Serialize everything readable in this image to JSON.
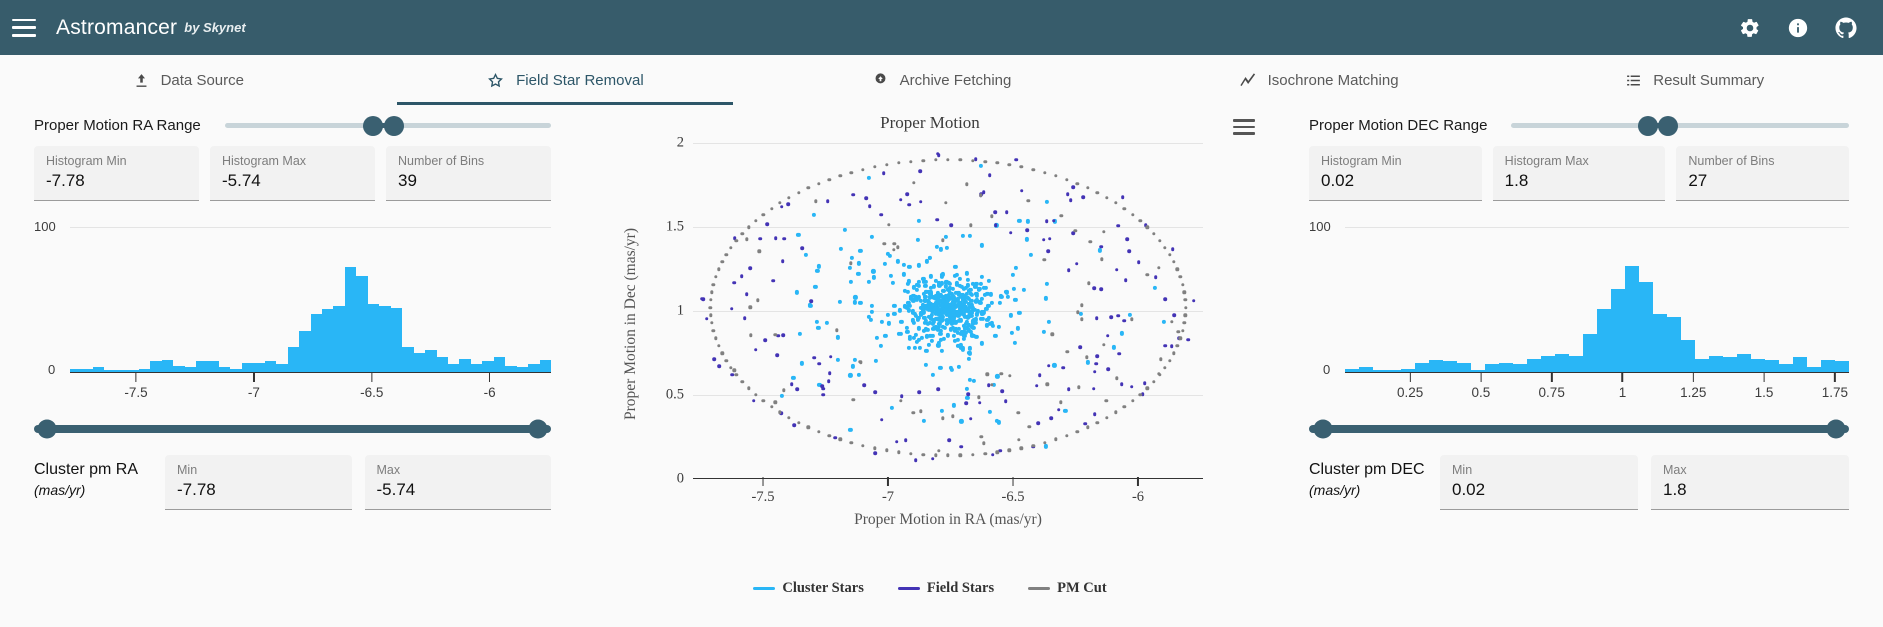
{
  "header": {
    "menu_icon": "hamburger-icon",
    "brand": "Astromancer",
    "brand_sub": "by Skynet",
    "icons": [
      "gear-icon",
      "info-icon",
      "github-icon"
    ]
  },
  "tabs": [
    {
      "label": "Data Source",
      "icon": "upload-icon",
      "active": false
    },
    {
      "label": "Field Star Removal",
      "icon": "star-icon",
      "active": true
    },
    {
      "label": "Archive Fetching",
      "icon": "download-icon",
      "active": false
    },
    {
      "label": "Isochrone Matching",
      "icon": "trending-icon",
      "active": false
    },
    {
      "label": "Result Summary",
      "icon": "list-icon",
      "active": false
    }
  ],
  "left_panel": {
    "range_label": "Proper Motion RA Range",
    "slider": {
      "left_pct": 45.5,
      "right_pct": 52.0
    },
    "fields": [
      {
        "label": "Histogram Min",
        "value": "-7.78"
      },
      {
        "label": "Histogram Max",
        "value": "-5.74"
      },
      {
        "label": "Number of Bins",
        "value": "39"
      }
    ],
    "bottom_slider": {
      "left_pct": 2.5,
      "right_pct": 97.5
    },
    "cluster": {
      "title": "Cluster pm RA",
      "units": "(mas/yr)",
      "min_label": "Min",
      "min_value": "-7.78",
      "max_label": "Max",
      "max_value": "-5.74"
    }
  },
  "right_panel": {
    "range_label": "Proper Motion DEC Range",
    "slider": {
      "left_pct": 40.5,
      "right_pct": 46.5
    },
    "fields": [
      {
        "label": "Histogram Min",
        "value": "0.02"
      },
      {
        "label": "Histogram Max",
        "value": "1.8"
      },
      {
        "label": "Number of Bins",
        "value": "27"
      }
    ],
    "bottom_slider": {
      "left_pct": 2.5,
      "right_pct": 97.5
    },
    "cluster": {
      "title": "Cluster pm DEC",
      "units": "(mas/yr)",
      "min_label": "Min",
      "min_value": "0.02",
      "max_label": "Max",
      "max_value": "1.8"
    }
  },
  "chart_data": [
    {
      "id": "hist_ra",
      "type": "bar",
      "title": "",
      "xlabel": "",
      "ylabel": "",
      "ylim": [
        0,
        100
      ],
      "xlim": [
        -7.78,
        -5.74
      ],
      "ytick_labels": [
        "100",
        "0"
      ],
      "xtick_labels": [
        "-7.5",
        "-7",
        "-6.5",
        "-6"
      ],
      "xtick_values": [
        -7.5,
        -7,
        -6.5,
        -6
      ],
      "grid": true,
      "bar_color": "#29b6f6",
      "bin_count": 39,
      "values": [
        2,
        2,
        3,
        1,
        0,
        1,
        2,
        7,
        8,
        4,
        3,
        7,
        7,
        3,
        2,
        6,
        6,
        7,
        5,
        17,
        28,
        40,
        43,
        45,
        72,
        66,
        47,
        45,
        44,
        17,
        13,
        15,
        10,
        5,
        9,
        5,
        7,
        10,
        4,
        3,
        5,
        8
      ]
    },
    {
      "id": "scatter_pm",
      "type": "scatter",
      "title": "Proper Motion",
      "xlabel": "Proper Motion in RA (mas/yr)",
      "ylabel": "Proper Motion in Dec (mas/yr)",
      "xlim": [
        -7.78,
        -5.74
      ],
      "ylim": [
        0,
        2
      ],
      "ytick_labels": [
        "2",
        "1.5",
        "1",
        "0.5",
        "0"
      ],
      "ytick_values": [
        2,
        1.5,
        1,
        0.5,
        0
      ],
      "xtick_labels": [
        "-7.5",
        "-7",
        "-6.5",
        "-6"
      ],
      "xtick_values": [
        -7.5,
        -7,
        -6.5,
        -6
      ],
      "grid": true,
      "legend_position": "bottom",
      "series": [
        {
          "name": "Cluster Stars",
          "color": "#29b6f6"
        },
        {
          "name": "Field Stars",
          "color": "#4333b5"
        },
        {
          "name": "PM Cut",
          "color": "#808080"
        }
      ]
    },
    {
      "id": "hist_dec",
      "type": "bar",
      "title": "",
      "xlabel": "",
      "ylabel": "",
      "ylim": [
        0,
        100
      ],
      "xlim": [
        0.02,
        1.8
      ],
      "ytick_labels": [
        "100",
        "0"
      ],
      "xtick_labels": [
        "0.25",
        "0.5",
        "0.75",
        "1",
        "1.25",
        "1.5",
        "1.75"
      ],
      "xtick_values": [
        0.25,
        0.5,
        0.75,
        1,
        1.25,
        1.5,
        1.75
      ],
      "grid": true,
      "bar_color": "#29b6f6",
      "bin_count": 27,
      "values": [
        2,
        3,
        1,
        1,
        2,
        6,
        8,
        7,
        6,
        1,
        5,
        6,
        5,
        9,
        11,
        12,
        11,
        26,
        43,
        57,
        73,
        62,
        40,
        38,
        22,
        9,
        11,
        10,
        12,
        9,
        8,
        5,
        10,
        3,
        8,
        7
      ]
    }
  ]
}
